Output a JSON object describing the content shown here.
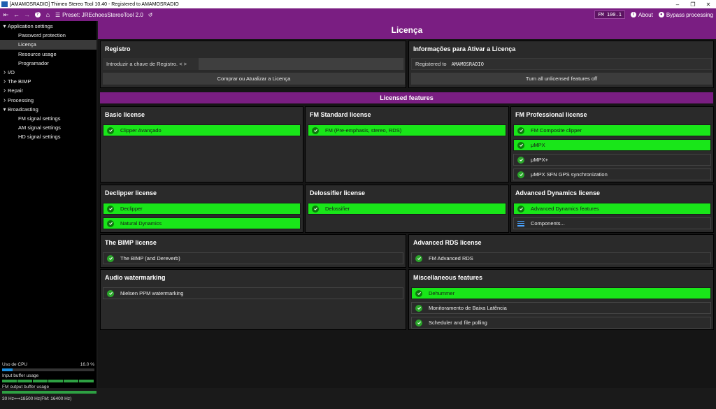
{
  "window": {
    "title": "[AMAMOSRADIO] Thimeo Stereo Tool 10.40 - Registered to AMAMOSRADIO"
  },
  "toolbar": {
    "preset_label": "Preset: JREchoesStereoTool 2.0",
    "fm_value": "FM 100.1",
    "about_label": "About",
    "bypass_label": "Bypass processing"
  },
  "sidebar": {
    "items": [
      {
        "label": "Application settings",
        "arrow": "⌄",
        "child": false
      },
      {
        "label": "Password protection",
        "child": true
      },
      {
        "label": "Licença",
        "child": true,
        "selected": true
      },
      {
        "label": "Resource usage",
        "child": true
      },
      {
        "label": "Programador",
        "child": true
      },
      {
        "label": "I/O",
        "arrow": "›",
        "child": false
      },
      {
        "label": "The BIMP",
        "arrow": "›",
        "child": false
      },
      {
        "label": "Repair",
        "arrow": "›",
        "child": false
      },
      {
        "label": "Processing",
        "arrow": "›",
        "child": false
      },
      {
        "label": "Broadcasting",
        "arrow": "⌄",
        "child": false
      },
      {
        "label": "FM signal settings",
        "child": true
      },
      {
        "label": "AM signal settings",
        "child": true
      },
      {
        "label": "HD signal settings",
        "child": true
      }
    ]
  },
  "status": {
    "cpu_label": "Uso de CPU",
    "cpu_value": "16.0 %",
    "cpu_fraction": 0.16,
    "input_buffer_label": "Input buffer usage",
    "fm_output_label": "FM output buffer usage",
    "freq_text": "30 Hz⟺18500 Hz(FM: 16400 Hz)"
  },
  "page": {
    "title": "Licença"
  },
  "registro": {
    "header": "Registro",
    "key_label": "Introduzir a chave de Registro. < >",
    "key_value": "",
    "button": "Comprar ou Atualizar a Licença"
  },
  "info": {
    "header": "Informações para Ativar a Licença",
    "registered_label": "Registered to",
    "registered_value": "AMAMOSRADIO",
    "button": "Turn all unlicensed features off"
  },
  "licensed_features_title": "Licensed features",
  "licenses": {
    "basic": {
      "header": "Basic license",
      "features": [
        {
          "label": "Clipper Avançado",
          "on": true
        }
      ]
    },
    "fm_standard": {
      "header": "FM Standard license",
      "features": [
        {
          "label": "FM (Pre-emphasis, stereo, RDS)",
          "on": true
        }
      ]
    },
    "fm_pro": {
      "header": "FM Professional license",
      "features": [
        {
          "label": "FM Composite clipper",
          "on": true
        },
        {
          "label": "μMPX",
          "on": true
        },
        {
          "label": "μMPX+",
          "on": false
        },
        {
          "label": "μMPX SFN GPS synchronization",
          "on": false
        }
      ]
    },
    "declipper": {
      "header": "Declipper license",
      "features": [
        {
          "label": "Declipper",
          "on": true
        },
        {
          "label": "Natural Dynamics",
          "on": true
        }
      ]
    },
    "delossifier": {
      "header": "Delossifier license",
      "features": [
        {
          "label": "Delossifier",
          "on": true
        }
      ]
    },
    "adv_dynamics": {
      "header": "Advanced Dynamics license",
      "features": [
        {
          "label": "Advanced Dynamics features",
          "on": true
        }
      ],
      "components_label": "Components..."
    },
    "bimp": {
      "header": "The BIMP license",
      "features": [
        {
          "label": "The BIMP (and Dereverb)",
          "on": false
        }
      ]
    },
    "adv_rds": {
      "header": "Advanced RDS license",
      "features": [
        {
          "label": "FM Advanced RDS",
          "on": false
        }
      ]
    },
    "watermark": {
      "header": "Audio watermarking",
      "features": [
        {
          "label": "Nielsen PPM watermarking",
          "on": false
        }
      ]
    },
    "misc": {
      "header": "Miscellaneous features",
      "features": [
        {
          "label": "Dehummer",
          "on": true
        },
        {
          "label": "Monitoramento de Baixa Latência",
          "on": false
        },
        {
          "label": "Scheduler and file polling",
          "on": false
        }
      ]
    }
  },
  "colors": {
    "accent": "#7a1e82",
    "licensed_green": "#19e619",
    "background": "#151515"
  }
}
